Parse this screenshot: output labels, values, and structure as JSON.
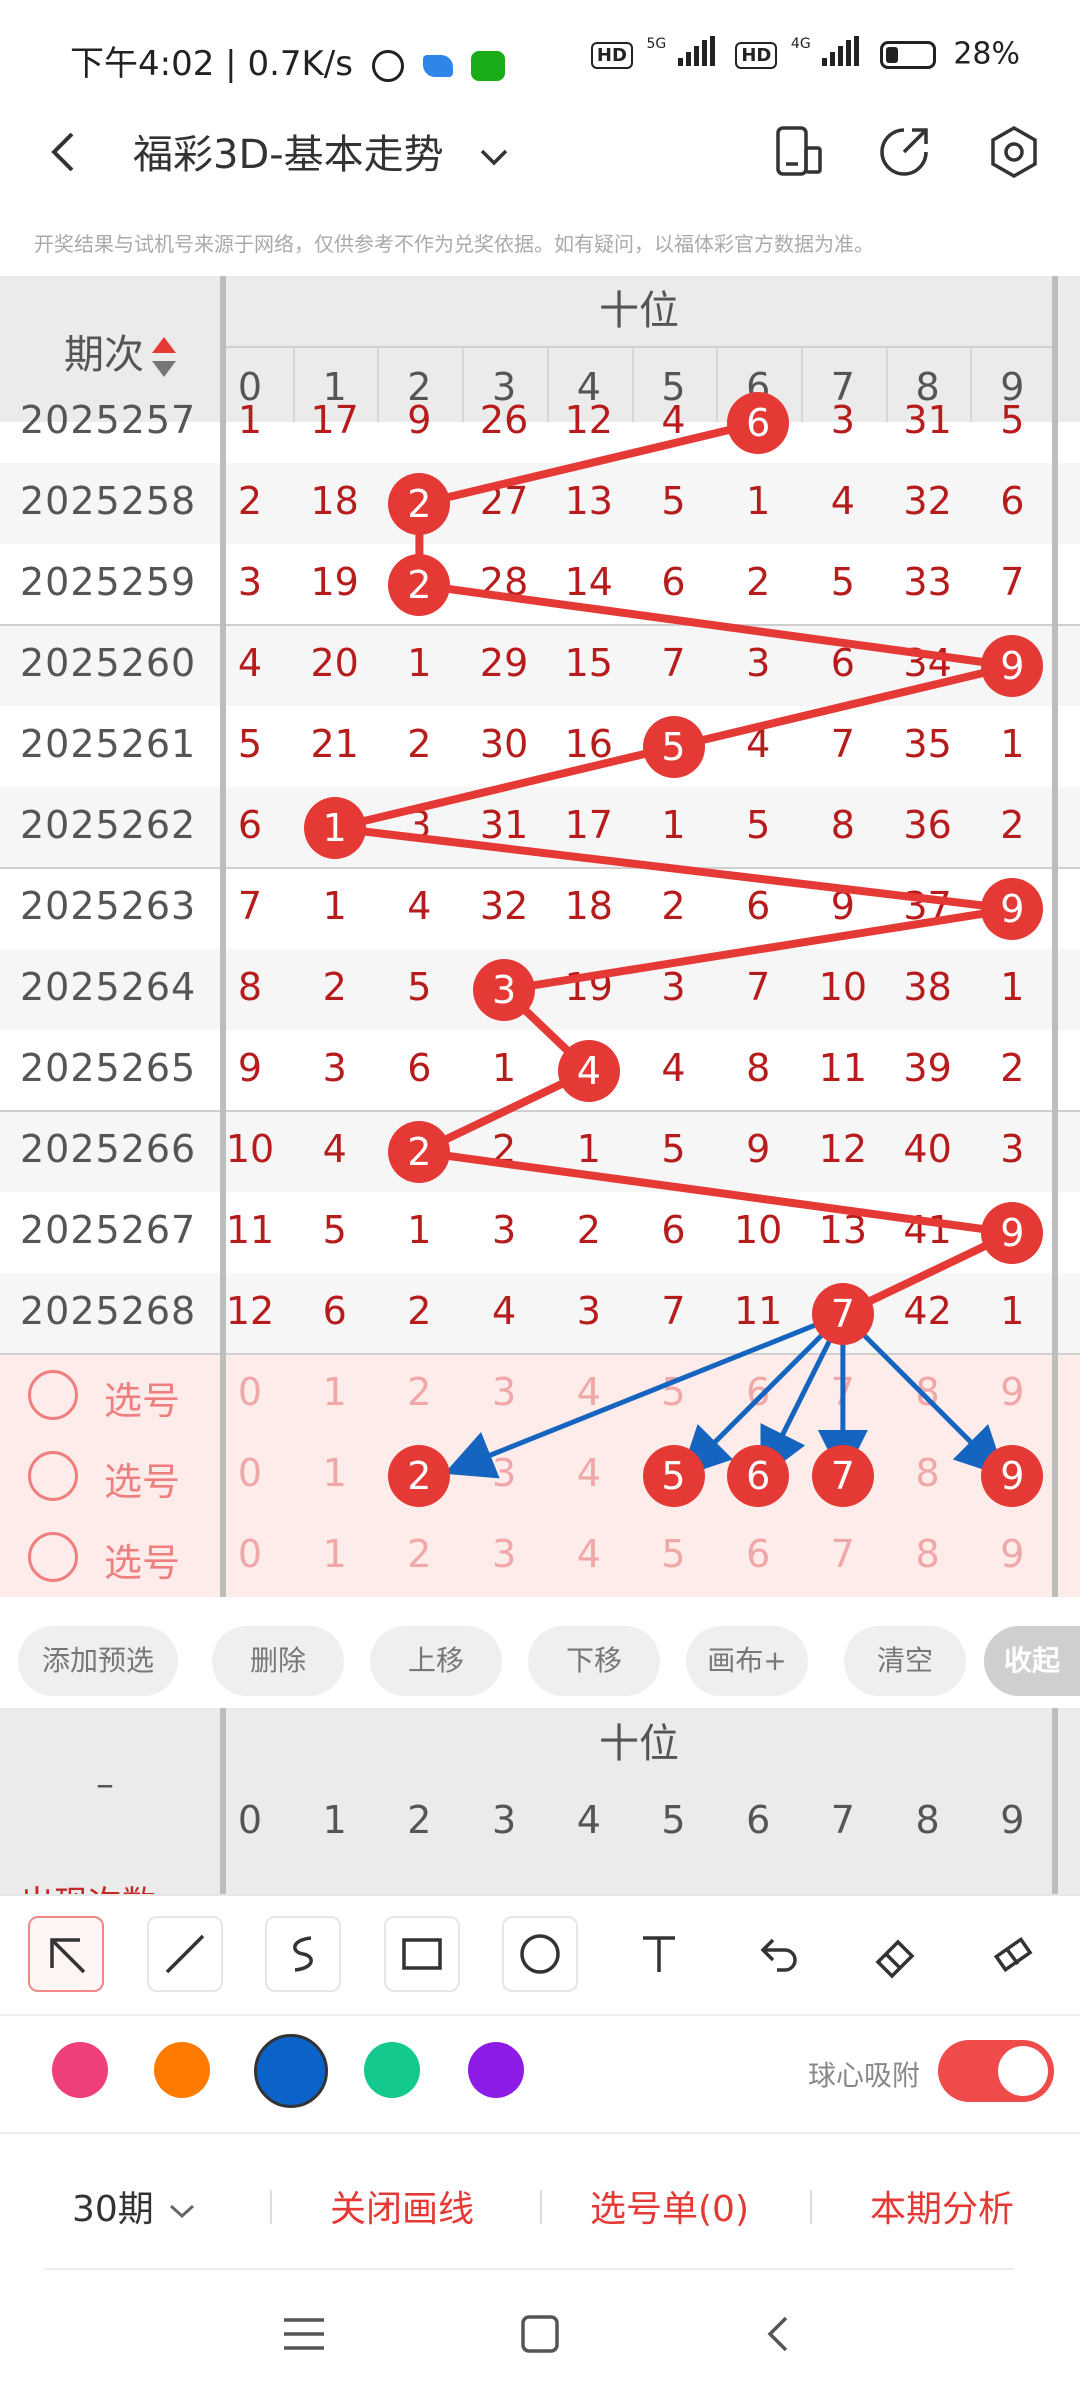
{
  "status_bar": {
    "time": "下午4:02",
    "speed": "0.7K/s",
    "sim1_tag": "HD",
    "sim1_net": "5G",
    "sim2_tag": "HD",
    "sim2_net": "4G",
    "battery_level_pct": 28,
    "battery_text": "28%"
  },
  "header": {
    "title": "福彩3D-基本走势"
  },
  "disclaimer": "开奖结果与试机号来源于网络，仅供参考不作为兑奖依据。如有疑问，以福体彩官方数据为准。",
  "table": {
    "period_header": "期次",
    "group_title": "十位",
    "digit_headers": [
      "0",
      "1",
      "2",
      "3",
      "4",
      "5",
      "6",
      "7",
      "8",
      "9"
    ],
    "rows": [
      {
        "period": "2025257",
        "cells": [
          "1",
          "17",
          "9",
          "26",
          "12",
          "4",
          "6",
          "3",
          "31",
          "5"
        ],
        "hit": 6
      },
      {
        "period": "2025258",
        "cells": [
          "2",
          "18",
          "2",
          "27",
          "13",
          "5",
          "1",
          "4",
          "32",
          "6"
        ],
        "hit": 2
      },
      {
        "period": "2025259",
        "cells": [
          "3",
          "19",
          "2",
          "28",
          "14",
          "6",
          "2",
          "5",
          "33",
          "7"
        ],
        "hit": 2
      },
      {
        "period": "2025260",
        "cells": [
          "4",
          "20",
          "1",
          "29",
          "15",
          "7",
          "3",
          "6",
          "34",
          "9"
        ],
        "hit": 9
      },
      {
        "period": "2025261",
        "cells": [
          "5",
          "21",
          "2",
          "30",
          "16",
          "5",
          "4",
          "7",
          "35",
          "1"
        ],
        "hit": 5
      },
      {
        "period": "2025262",
        "cells": [
          "6",
          "1",
          "3",
          "31",
          "17",
          "1",
          "5",
          "8",
          "36",
          "2"
        ],
        "hit": 1
      },
      {
        "period": "2025263",
        "cells": [
          "7",
          "1",
          "4",
          "32",
          "18",
          "2",
          "6",
          "9",
          "37",
          "9"
        ],
        "hit": 9
      },
      {
        "period": "2025264",
        "cells": [
          "8",
          "2",
          "5",
          "3",
          "19",
          "3",
          "7",
          "10",
          "38",
          "1"
        ],
        "hit": 3
      },
      {
        "period": "2025265",
        "cells": [
          "9",
          "3",
          "6",
          "1",
          "4",
          "4",
          "8",
          "11",
          "39",
          "2"
        ],
        "hit": 4
      },
      {
        "period": "2025266",
        "cells": [
          "10",
          "4",
          "2",
          "2",
          "1",
          "5",
          "9",
          "12",
          "40",
          "3"
        ],
        "hit": 2
      },
      {
        "period": "2025267",
        "cells": [
          "11",
          "5",
          "1",
          "3",
          "2",
          "6",
          "10",
          "13",
          "41",
          "9"
        ],
        "hit": 9
      },
      {
        "period": "2025268",
        "cells": [
          "12",
          "6",
          "2",
          "4",
          "3",
          "7",
          "11",
          "7",
          "42",
          "1"
        ],
        "hit": 7
      }
    ],
    "pick_rows": [
      {
        "label": "选号",
        "cells": [
          "0",
          "1",
          "2",
          "3",
          "4",
          "5",
          "6",
          "7",
          "8",
          "9"
        ],
        "selected": []
      },
      {
        "label": "选号",
        "cells": [
          "0",
          "1",
          "2",
          "3",
          "4",
          "5",
          "6",
          "7",
          "8",
          "9"
        ],
        "selected": [
          2,
          5,
          6,
          7,
          9
        ]
      },
      {
        "label": "选号",
        "cells": [
          "0",
          "1",
          "2",
          "3",
          "4",
          "5",
          "6",
          "7",
          "8",
          "9"
        ],
        "selected": []
      }
    ]
  },
  "actions": [
    "添加预选",
    "删除",
    "上移",
    "下移",
    "画布+",
    "清空",
    "收起"
  ],
  "stats_table": {
    "left_header": "–",
    "group_title": "十位",
    "digit_headers": [
      "0",
      "1",
      "2",
      "3",
      "4",
      "5",
      "6",
      "7",
      "8",
      "9"
    ],
    "partial_row_label": "出现次数"
  },
  "tools": [
    "pointer-icon",
    "line-icon",
    "curve-icon",
    "rectangle-icon",
    "circle-icon",
    "text-icon",
    "undo-icon",
    "eraser-icon",
    "clear-brush-icon"
  ],
  "colors": {
    "swatches": [
      "#ef3f7a",
      "#ff7a00",
      "#0b62c8",
      "#13c98d",
      "#8d1ce6"
    ],
    "selected": "#0b62c8",
    "accent": "#e53935"
  },
  "snap_toggle": {
    "label": "球心吸附",
    "on": true
  },
  "bottom_bar": {
    "periods": "30期",
    "close_lines": "关闭画线",
    "pick_list": "选号单(0)",
    "analysis": "本期分析"
  }
}
